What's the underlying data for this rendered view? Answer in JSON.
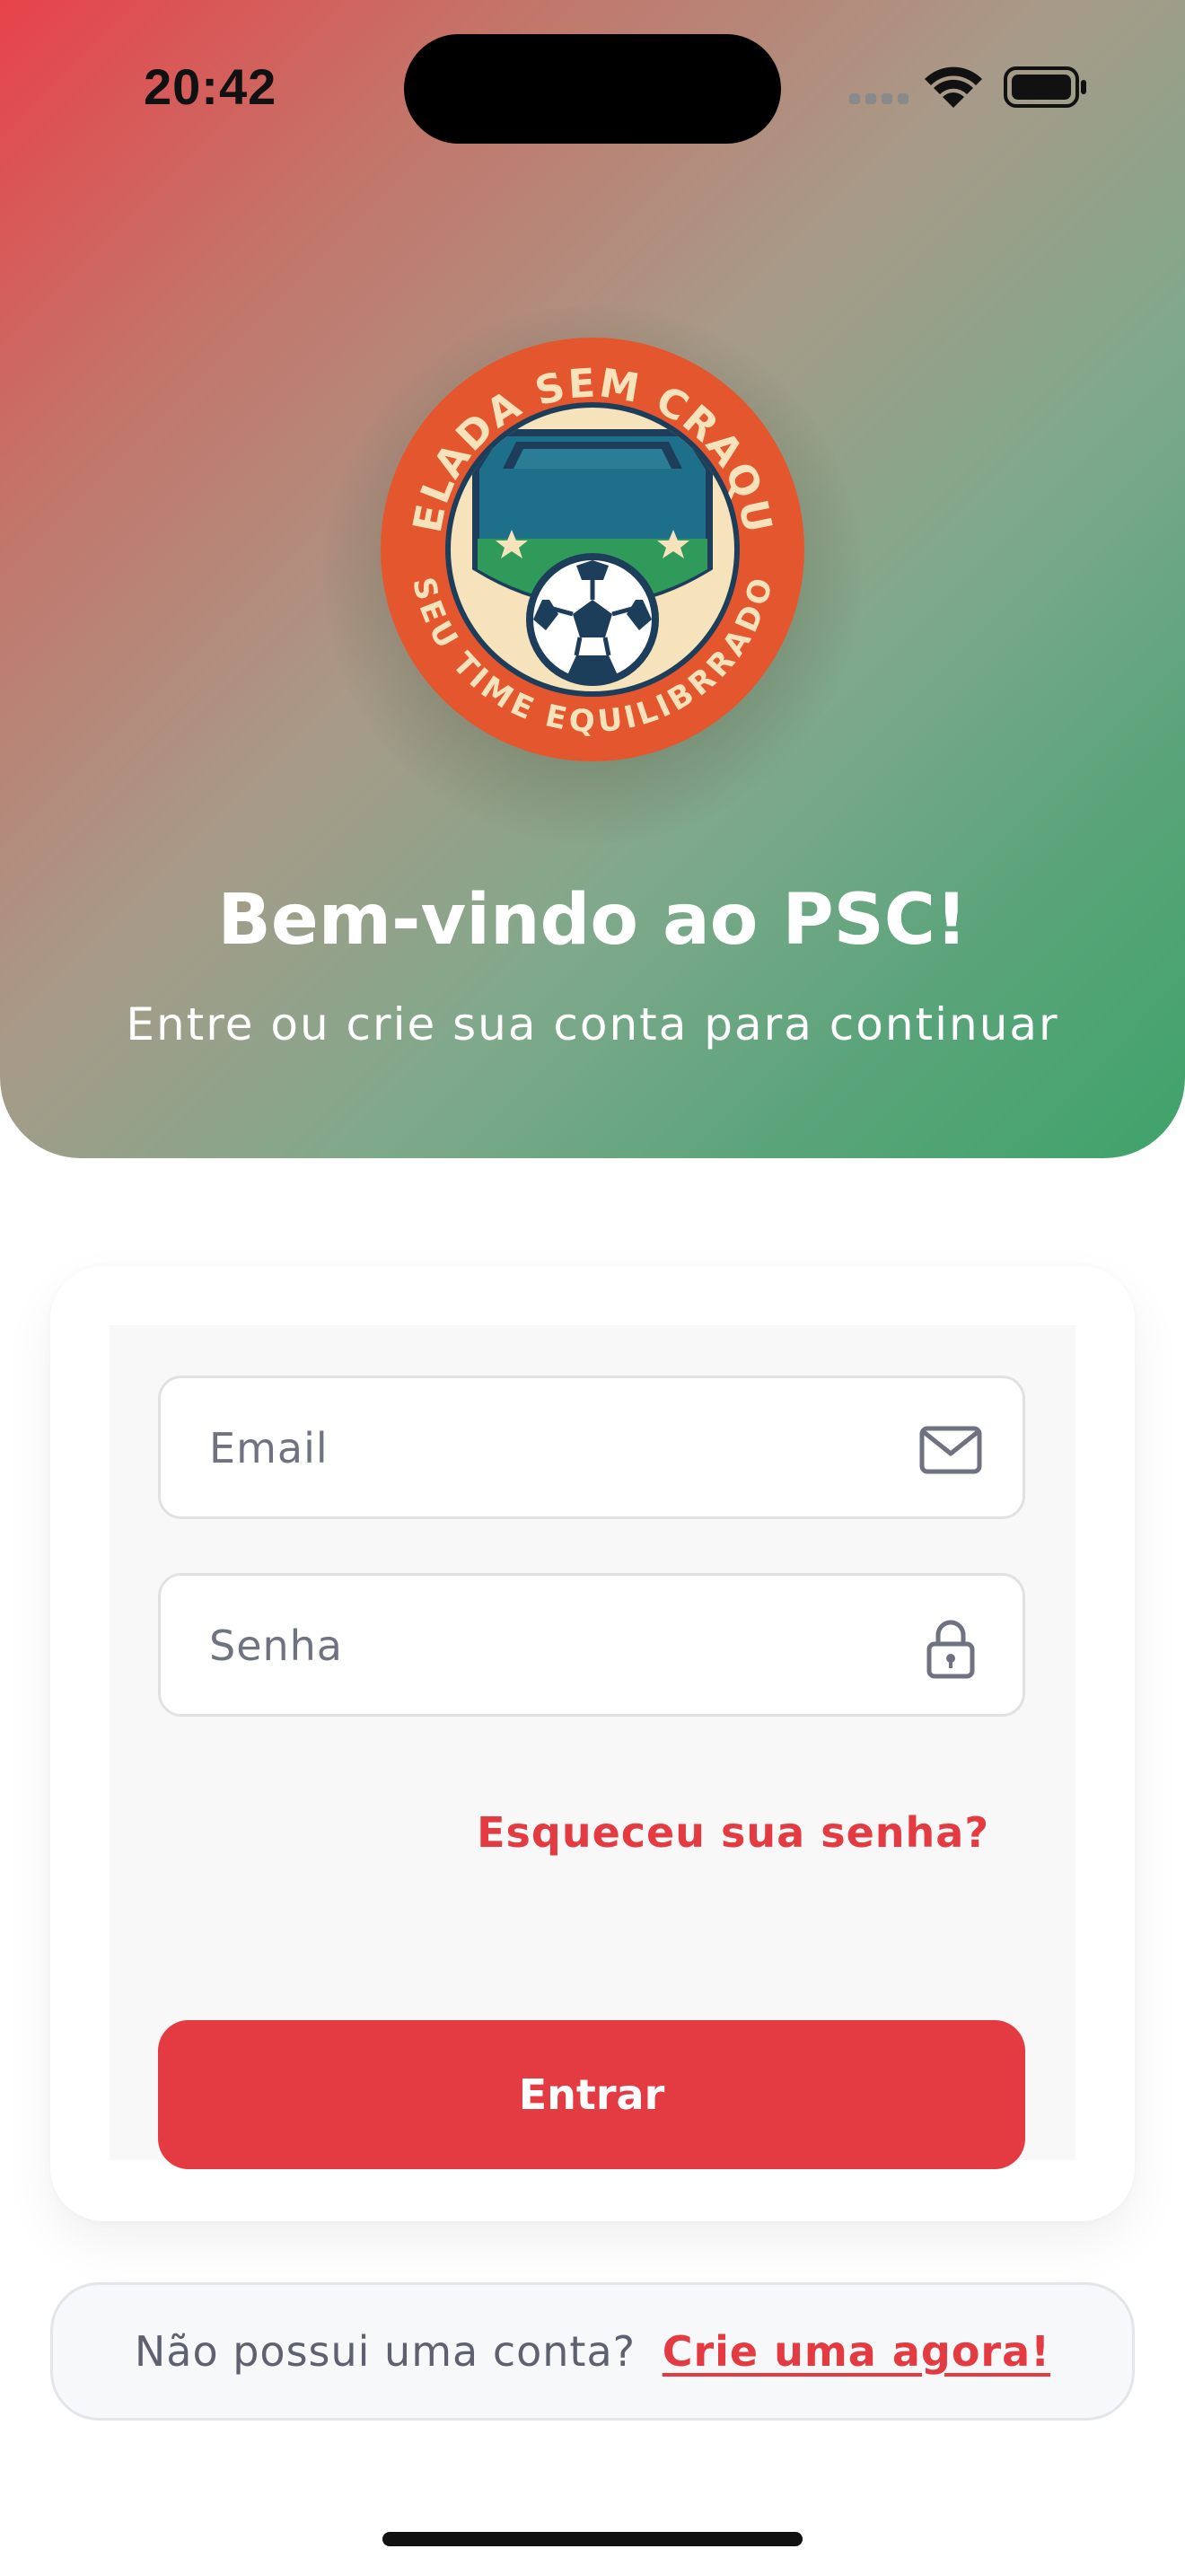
{
  "status_bar": {
    "time": "20:42"
  },
  "logo": {
    "top_text": "PELADA SEM CRAQUE",
    "bottom_text": "SEU TIME EQUILIBRRADO",
    "colors": {
      "ring": "#e4572e",
      "cream": "#f6e2bb",
      "navy": "#1d3e5a",
      "teal": "#1e6f8a",
      "green": "#2f9a5a"
    }
  },
  "hero": {
    "title": "Bem-vindo ao PSC!",
    "subtitle": "Entre ou crie sua conta para continuar"
  },
  "form": {
    "email_placeholder": "Email",
    "email_icon": "mail-icon",
    "password_placeholder": "Senha",
    "password_icon": "lock-icon",
    "forgot_label": "Esqueceu sua senha?",
    "login_label": "Entrar"
  },
  "signup": {
    "prompt": "Não possui uma conta?",
    "link_label": "Crie uma agora!"
  },
  "colors": {
    "accent": "#e33b41",
    "gradient_start": "#e8424a",
    "gradient_end": "#3fa36a"
  }
}
